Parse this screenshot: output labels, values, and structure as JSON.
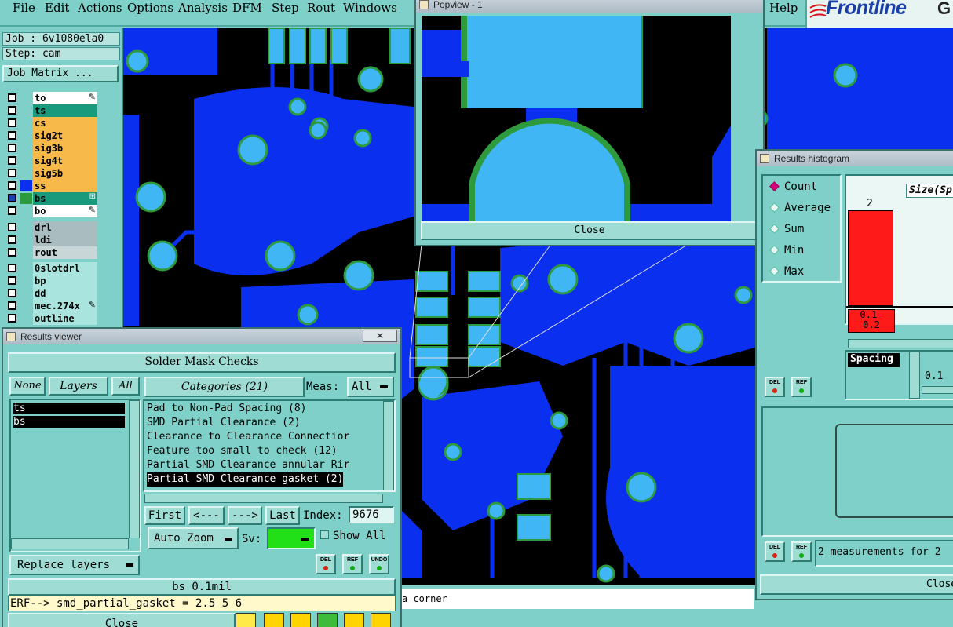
{
  "menu": [
    "File",
    "Edit",
    "Actions",
    "Options",
    "Analysis",
    "DFM",
    "Step",
    "Rout",
    "Windows"
  ],
  "menu_right": "Help",
  "logo": {
    "text": "Frontline",
    "suffix": "G"
  },
  "job": {
    "job_label": "Job : 6v1080ela0",
    "step_label": "Step: cam",
    "matrix_button": "Job Matrix ..."
  },
  "layers": [
    {
      "name": "to",
      "color": "#ffffff",
      "extra": "pen"
    },
    {
      "name": "ts",
      "color": "#1a9a7c",
      "extra": ""
    },
    {
      "name": "cs",
      "color": "#f6b94a",
      "extra": ""
    },
    {
      "name": "sig2t",
      "color": "#f6b94a",
      "extra": ""
    },
    {
      "name": "sig3b",
      "color": "#f6b94a",
      "extra": ""
    },
    {
      "name": "sig4t",
      "color": "#f6b94a",
      "extra": ""
    },
    {
      "name": "sig5b",
      "color": "#f6b94a",
      "extra": ""
    },
    {
      "name": "ss",
      "color": "#f6b94a",
      "extra": ""
    },
    {
      "name": "bs",
      "color": "#1a9a7c",
      "extra": "grid"
    },
    {
      "name": "bo",
      "color": "#ffffff",
      "extra": "pen"
    }
  ],
  "layers2": [
    {
      "name": "drl",
      "color": "#a9bcc0"
    },
    {
      "name": "ldi",
      "color": "#a9bcc0"
    },
    {
      "name": "rout",
      "color": "#c8d6d8"
    }
  ],
  "layers3": [
    {
      "name": "0slotdrl",
      "color": "#a9e4de"
    },
    {
      "name": "bp",
      "color": "#a9e4de"
    },
    {
      "name": "dd",
      "color": "#a9e4de"
    },
    {
      "name": "mec.274x",
      "color": "#a9e4de",
      "extra": "pen"
    },
    {
      "name": "outline",
      "color": "#a9e4de"
    }
  ],
  "results_viewer": {
    "title": "Results viewer",
    "heading": "Solder Mask Checks",
    "none_btn": "None",
    "layers_btn": "Layers",
    "all_btn": "All",
    "categories_btn": "Categories (21)",
    "meas_label": "Meas:",
    "meas_value": "All",
    "selected_layers": [
      "ts",
      "bs"
    ],
    "categories": [
      "Pad to Non-Pad Spacing (8)",
      "SMD Partial Clearance (2)",
      "Clearance to Clearance Connectior",
      "Feature too small to check (12)",
      "Partial SMD Clearance annular Rir",
      "Partial SMD Clearance gasket (2)"
    ],
    "nav": {
      "first": "First",
      "prev": "<---",
      "next": "--->",
      "last": "Last",
      "index_label": "Index:",
      "index_value": "9676"
    },
    "auto_zoom": "Auto Zoom",
    "sv_label": "Sv:",
    "show_all": "Show All",
    "replace_layers": "Replace layers",
    "del": "DEL",
    "ref": "REF",
    "undo": "UNDO",
    "status_layer": "bs 0.1mil",
    "erf_line": "ERF--> smd_partial_gasket = 2.5 5 6",
    "close": "Close"
  },
  "popview": {
    "title": "Popview - 1",
    "close": "Close"
  },
  "histogram": {
    "title": "Results histogram",
    "options": [
      "Count",
      "Average",
      "Sum",
      "Min",
      "Max"
    ],
    "selected": "Count",
    "size_label": "Size(Sp",
    "bar_value": "2",
    "bar_range": "0.1-\n0.2",
    "measure_item": "Spacing",
    "slider_value": "0.1",
    "measurements_text": "2 measurements for 2",
    "close": "Close",
    "del": "DEL",
    "ref": "REF",
    "bar_color": "#ff1a1a"
  },
  "status_hint": "a corner"
}
